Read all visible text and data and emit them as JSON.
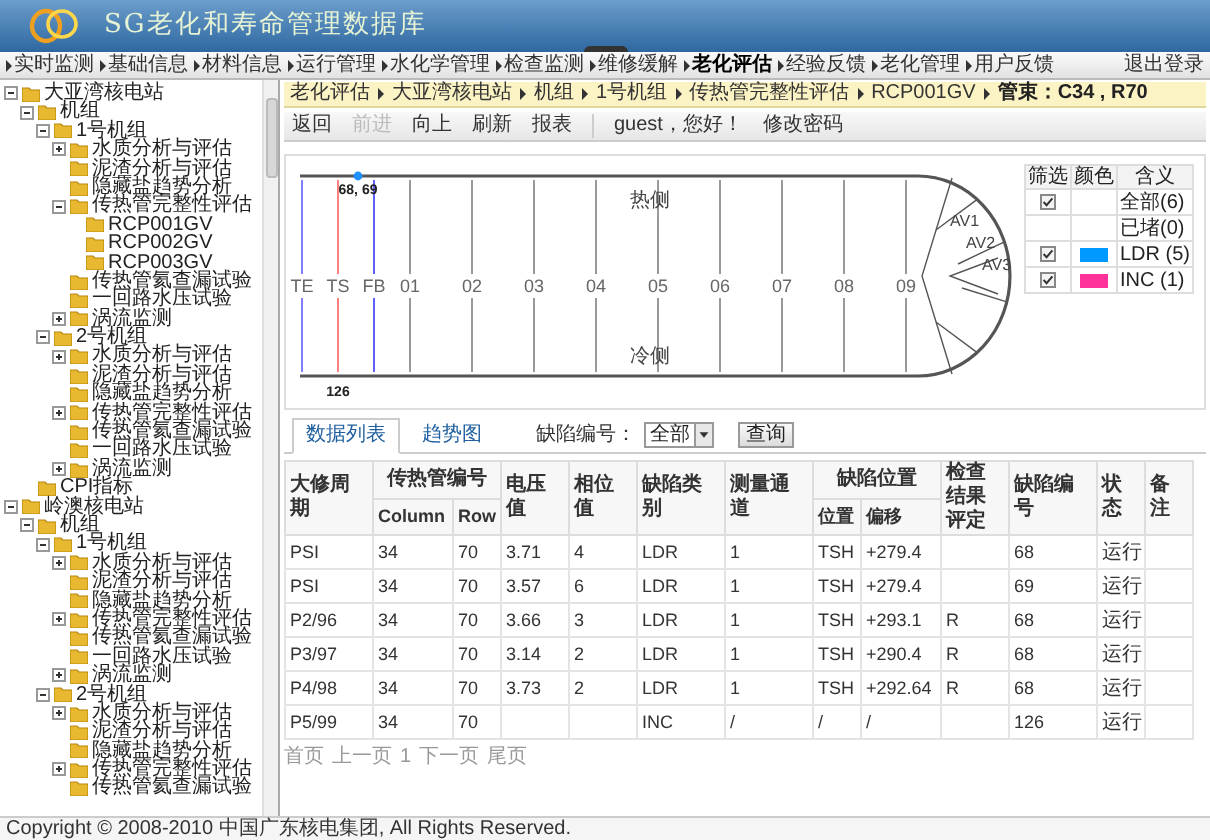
{
  "header": {
    "title": "SG老化和寿命管理数据库"
  },
  "menu": [
    {
      "label": "实时监测",
      "selected": false
    },
    {
      "label": "基础信息",
      "selected": false
    },
    {
      "label": "材料信息",
      "selected": false
    },
    {
      "label": "运行管理",
      "selected": false
    },
    {
      "label": "水化学管理",
      "selected": false
    },
    {
      "label": "检查监测",
      "selected": false
    },
    {
      "label": "维修缓解",
      "selected": false
    },
    {
      "label": "老化评估",
      "selected": true
    },
    {
      "label": "经验反馈",
      "selected": false
    },
    {
      "label": "老化管理",
      "selected": false
    },
    {
      "label": "用户反馈",
      "selected": false
    }
  ],
  "logout": "退出登录",
  "tree": [
    {
      "label": "大亚湾核电站",
      "expanded": true,
      "children": [
        {
          "label": "机组",
          "expanded": true,
          "children": [
            {
              "label": "1号机组",
              "expanded": true,
              "children": [
                {
                  "label": "水质分析与评估",
                  "expanded": false
                },
                {
                  "label": "泥渣分析与评估"
                },
                {
                  "label": "隐藏盐趋势分析"
                },
                {
                  "label": "传热管完整性评估",
                  "expanded": true,
                  "children": [
                    {
                      "label": "RCP001GV"
                    },
                    {
                      "label": "RCP002GV"
                    },
                    {
                      "label": "RCP003GV"
                    }
                  ]
                },
                {
                  "label": "传热管氦查漏试验"
                },
                {
                  "label": "一回路水压试验"
                },
                {
                  "label": "涡流监测",
                  "expanded": false
                }
              ]
            },
            {
              "label": "2号机组",
              "expanded": true,
              "children": [
                {
                  "label": "水质分析与评估",
                  "expanded": false
                },
                {
                  "label": "泥渣分析与评估"
                },
                {
                  "label": "隐藏盐趋势分析"
                },
                {
                  "label": "传热管完整性评估",
                  "expanded": false
                },
                {
                  "label": "传热管氦查漏试验"
                },
                {
                  "label": "一回路水压试验"
                },
                {
                  "label": "涡流监测",
                  "expanded": false
                }
              ]
            }
          ]
        },
        {
          "label": "CPI指标"
        }
      ]
    },
    {
      "label": "岭澳核电站",
      "expanded": true,
      "children": [
        {
          "label": "机组",
          "expanded": true,
          "children": [
            {
              "label": "1号机组",
              "expanded": true,
              "children": [
                {
                  "label": "水质分析与评估",
                  "expanded": false
                },
                {
                  "label": "泥渣分析与评估"
                },
                {
                  "label": "隐藏盐趋势分析"
                },
                {
                  "label": "传热管完整性评估",
                  "expanded": false
                },
                {
                  "label": "传热管氦查漏试验"
                },
                {
                  "label": "一回路水压试验"
                },
                {
                  "label": "涡流监测",
                  "expanded": false
                }
              ]
            },
            {
              "label": "2号机组",
              "expanded": true,
              "children": [
                {
                  "label": "水质分析与评估",
                  "expanded": false
                },
                {
                  "label": "泥渣分析与评估"
                },
                {
                  "label": "隐藏盐趋势分析"
                },
                {
                  "label": "传热管完整性评估",
                  "expanded": false
                },
                {
                  "label": "传热管氦查漏试验"
                }
              ]
            }
          ]
        }
      ]
    }
  ],
  "breadcrumb": [
    "老化评估",
    "大亚湾核电站",
    "机组",
    "1号机组",
    "传热管完整性评估",
    "RCP001GV",
    "管束：C34 , R70"
  ],
  "toolbar": {
    "buttons": [
      {
        "label": "返回",
        "disabled": false
      },
      {
        "label": "前进",
        "disabled": true
      },
      {
        "label": "向上",
        "disabled": false
      },
      {
        "label": "刷新",
        "disabled": false
      },
      {
        "label": "报表",
        "disabled": false
      }
    ],
    "greeting": "guest，您好！",
    "change_password": "修改密码"
  },
  "diagram": {
    "hot_side": "热侧",
    "cold_side": "冷侧",
    "stations": [
      {
        "label": "TE",
        "color": "#8080ff"
      },
      {
        "label": "TS",
        "color": "#ff8080"
      },
      {
        "label": "FB",
        "color": "#6060ff"
      },
      {
        "label": "01",
        "color": "#999999"
      },
      {
        "label": "02",
        "color": "#999999"
      },
      {
        "label": "03",
        "color": "#999999"
      },
      {
        "label": "04",
        "color": "#999999"
      },
      {
        "label": "05",
        "color": "#999999"
      },
      {
        "label": "06",
        "color": "#999999"
      },
      {
        "label": "07",
        "color": "#999999"
      },
      {
        "label": "08",
        "color": "#999999"
      },
      {
        "label": "09",
        "color": "#999999"
      }
    ],
    "vanes": [
      "AV1",
      "AV2",
      "AV3"
    ],
    "markers": [
      {
        "kind": "top",
        "label": "68, 69",
        "color": "#1e90ff"
      },
      {
        "kind": "bottom",
        "label": "126"
      }
    ]
  },
  "legend": {
    "columns": [
      "筛选",
      "颜色",
      "含义"
    ],
    "rows": [
      {
        "checked": true,
        "label": "全部(6)"
      },
      {
        "checked": false,
        "label": "已堵(0)"
      },
      {
        "checked": true,
        "color": "#0099ff",
        "label": "LDR (5)"
      },
      {
        "checked": true,
        "color": "#ff3399",
        "label": "INC (1)"
      }
    ]
  },
  "tabs": [
    {
      "label": "数据列表",
      "selected": true
    },
    {
      "label": "趋势图",
      "selected": false
    }
  ],
  "filter": {
    "label": "缺陷编号：",
    "value": "全部",
    "button": "查询"
  },
  "table": {
    "columns": [
      {
        "label": "大修周期"
      },
      {
        "label": "传热管编号",
        "colspan": 2,
        "children": [
          "Column",
          "Row"
        ]
      },
      {
        "label": "电压值"
      },
      {
        "label": "相位值"
      },
      {
        "label": "缺陷类别"
      },
      {
        "label": "测量通道"
      },
      {
        "label": "缺陷位置",
        "colspan": 2,
        "children": [
          "位置",
          "偏移"
        ]
      },
      {
        "label": "检查结果评定"
      },
      {
        "label": "缺陷编号"
      },
      {
        "label": "状态"
      },
      {
        "label": "备注"
      }
    ],
    "rows": [
      [
        "PSI",
        "34",
        "70",
        "3.71",
        "4",
        "LDR",
        "1",
        "TSH",
        "+279.4",
        null,
        "68",
        "运行",
        null
      ],
      [
        "PSI",
        "34",
        "70",
        "3.57",
        "6",
        "LDR",
        "1",
        "TSH",
        "+279.4",
        null,
        "69",
        "运行",
        null
      ],
      [
        "P2/96",
        "34",
        "70",
        "3.66",
        "3",
        "LDR",
        "1",
        "TSH",
        "+293.1",
        "R",
        "68",
        "运行",
        null
      ],
      [
        "P3/97",
        "34",
        "70",
        "3.14",
        "2",
        "LDR",
        "1",
        "TSH",
        "+290.4",
        "R",
        "68",
        "运行",
        null
      ],
      [
        "P4/98",
        "34",
        "70",
        "3.73",
        "2",
        "LDR",
        "1",
        "TSH",
        "+292.64",
        "R",
        "68",
        "运行",
        null
      ],
      [
        "P5/99",
        "34",
        "70",
        null,
        null,
        "INC",
        "/",
        "/",
        "/",
        null,
        "126",
        "运行",
        null
      ]
    ]
  },
  "pager": [
    "首页",
    "上一页",
    "1",
    "下一页",
    "尾页"
  ],
  "copyright": "Copyright © 2008-2010 中国广东核电集团, All Rights Reserved."
}
